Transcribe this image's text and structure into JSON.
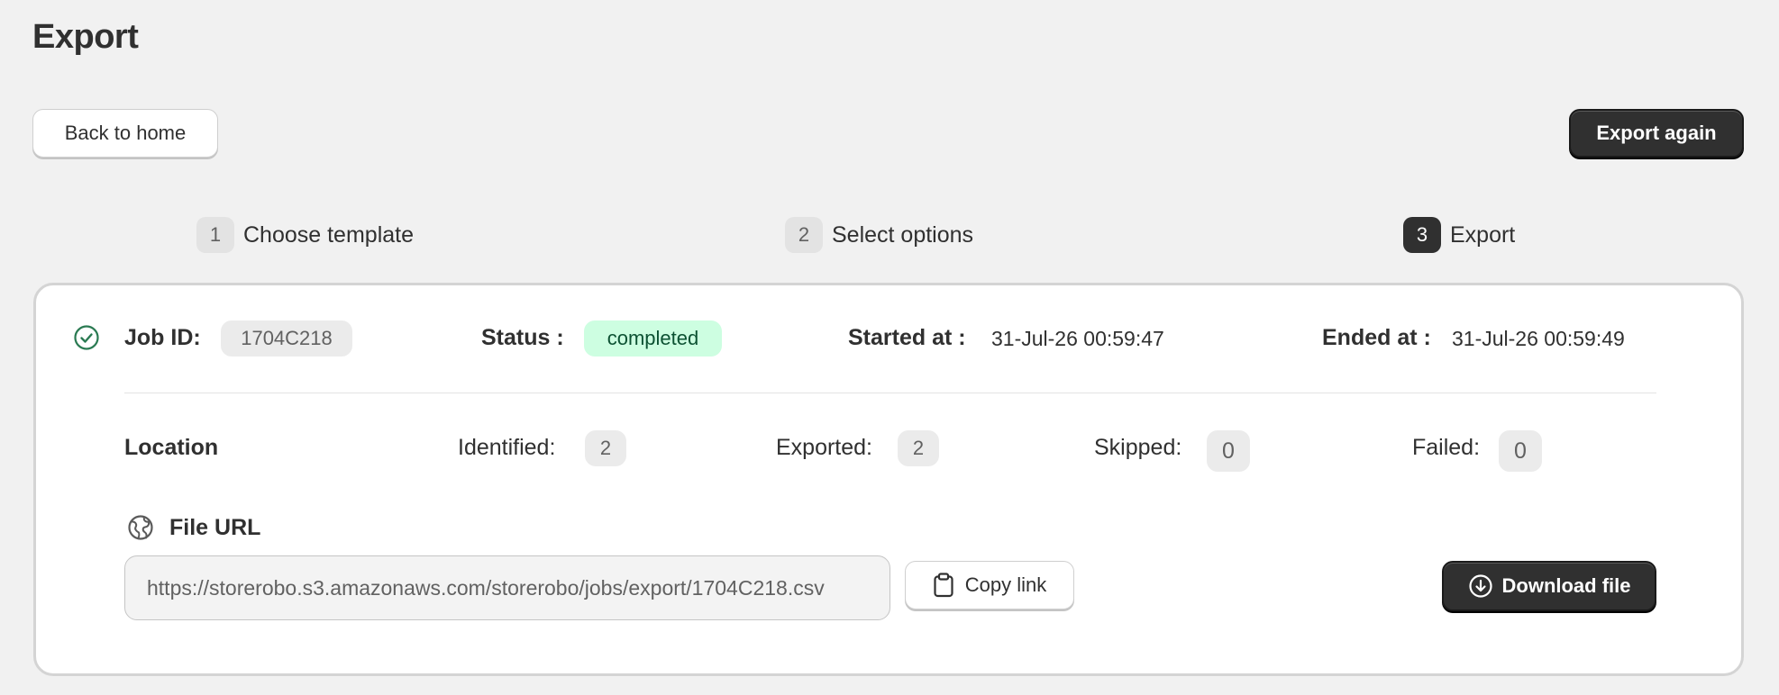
{
  "page": {
    "title": "Export"
  },
  "header": {
    "back_label": "Back to home",
    "export_again_label": "Export again"
  },
  "steps": [
    {
      "number": "1",
      "label": "Choose template",
      "active": false
    },
    {
      "number": "2",
      "label": "Select options",
      "active": false
    },
    {
      "number": "3",
      "label": "Export",
      "active": true
    }
  ],
  "job": {
    "id_label": "Job ID:",
    "id_value": "1704C218",
    "status_label": "Status :",
    "status_value": "completed",
    "started_label": "Started at :",
    "started_value": "31-Jul-26 00:59:47",
    "ended_label": "Ended at :",
    "ended_value": "31-Jul-26 00:59:49"
  },
  "counts": {
    "section_label": "Location",
    "identified_label": "Identified:",
    "identified_value": "2",
    "exported_label": "Exported:",
    "exported_value": "2",
    "skipped_label": "Skipped:",
    "skipped_value": "0",
    "failed_label": "Failed:",
    "failed_value": "0"
  },
  "file": {
    "label": "File URL",
    "url": "https://storerobo.s3.amazonaws.com/storerobo/jobs/export/1704C218.csv",
    "copy_label": "Copy link",
    "download_label": "Download file"
  },
  "icons": {
    "status": "check-circle-icon",
    "file": "globe-icon",
    "copy": "clipboard-icon",
    "download": "download-circle-icon"
  },
  "colors": {
    "primary": "#303030",
    "success_bg": "#cdfee1",
    "success_fg": "#0c5132",
    "check": "#2a7a52"
  }
}
